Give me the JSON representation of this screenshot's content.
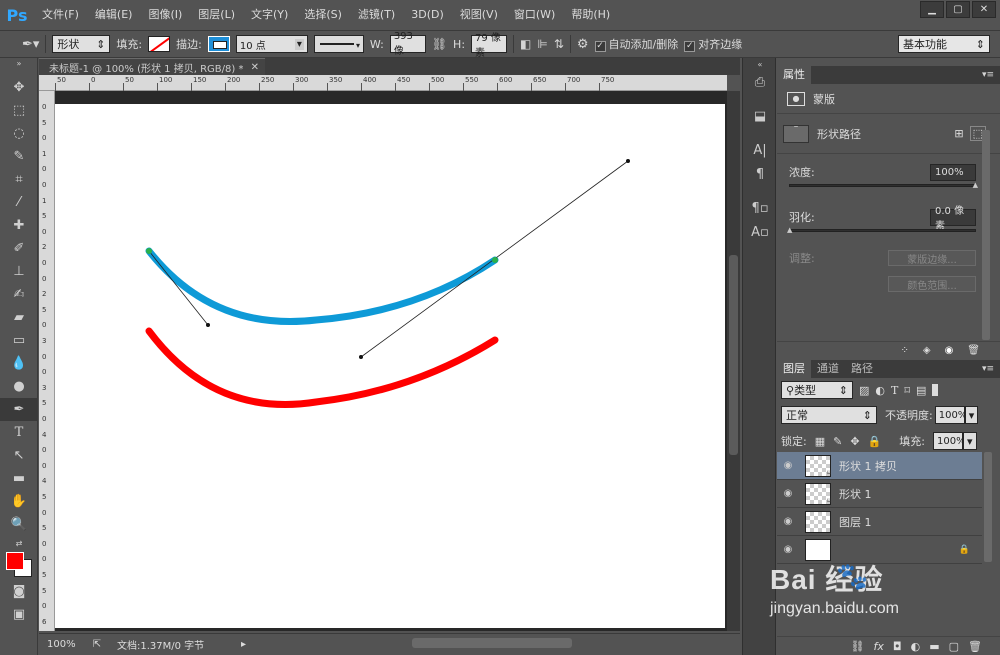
{
  "app": {
    "logo": "Ps"
  },
  "menu": [
    "文件(F)",
    "编辑(E)",
    "图像(I)",
    "图层(L)",
    "文字(Y)",
    "选择(S)",
    "滤镜(T)",
    "3D(D)",
    "视图(V)",
    "窗口(W)",
    "帮助(H)"
  ],
  "window_controls": {
    "minimize": "▁",
    "maximize": "▢",
    "close": "✕"
  },
  "options": {
    "mode": "形状",
    "fill_label": "填充:",
    "stroke_label": "描边:",
    "stroke_size": "10 点",
    "w_label": "W:",
    "w_value": "393 像",
    "h_label": "H:",
    "h_value": "79 像素",
    "auto_add_delete": "自动添加/删除",
    "align_edges": "对齐边缘",
    "workspace": "基本功能",
    "fill_color": "#ff0000",
    "stroke_color": "#1e8fd8"
  },
  "document": {
    "tab_title": "未标题-1 @ 100% (形状 1 拷贝, RGB/8) *",
    "zoom": "100%",
    "doc_info": "文档:1.37M/0 字节",
    "ruler_top": [
      "50",
      "0",
      "50",
      "100",
      "150",
      "200",
      "250",
      "300",
      "350",
      "400",
      "450",
      "500",
      "550",
      "600",
      "650",
      "700",
      "750"
    ],
    "ruler_left": [
      "0",
      "5",
      "0",
      "1",
      "0",
      "0",
      "1",
      "5",
      "0",
      "2",
      "0",
      "0",
      "2",
      "5",
      "0",
      "3",
      "0",
      "0",
      "3",
      "5",
      "0",
      "4",
      "0",
      "0",
      "4",
      "5",
      "0",
      "5",
      "0",
      "0",
      "5",
      "5",
      "0",
      "6"
    ],
    "blue_stroke_color": "#0e9ad7",
    "red_stroke_color": "#ff0000",
    "anchor_color": "#2ab04a"
  },
  "properties": {
    "tab": "属性",
    "mask_label": "蒙版",
    "shape_path_label": "形状路径",
    "density_label": "浓度:",
    "density_value": "100%",
    "feather_label": "羽化:",
    "feather_value": "0.0 像素",
    "adjust_label": "调整:",
    "mask_edge_button": "蒙版边缘...",
    "color_range_button": "颜色范围..."
  },
  "layers": {
    "tabs": [
      "图层",
      "通道",
      "路径"
    ],
    "filter_type": "类型",
    "blend_mode": "正常",
    "opacity_label": "不透明度:",
    "opacity_value": "100%",
    "lock_label": "锁定:",
    "fill_label": "填充:",
    "fill_value": "100%",
    "items": [
      {
        "name": "形状 1 拷贝",
        "selected": true
      },
      {
        "name": "形状 1",
        "selected": false
      },
      {
        "name": "图层 1",
        "selected": false
      },
      {
        "name": "",
        "selected": false
      }
    ]
  },
  "watermark": {
    "brand": "Bai  经验",
    "url": "jingyan.baidu.com"
  }
}
